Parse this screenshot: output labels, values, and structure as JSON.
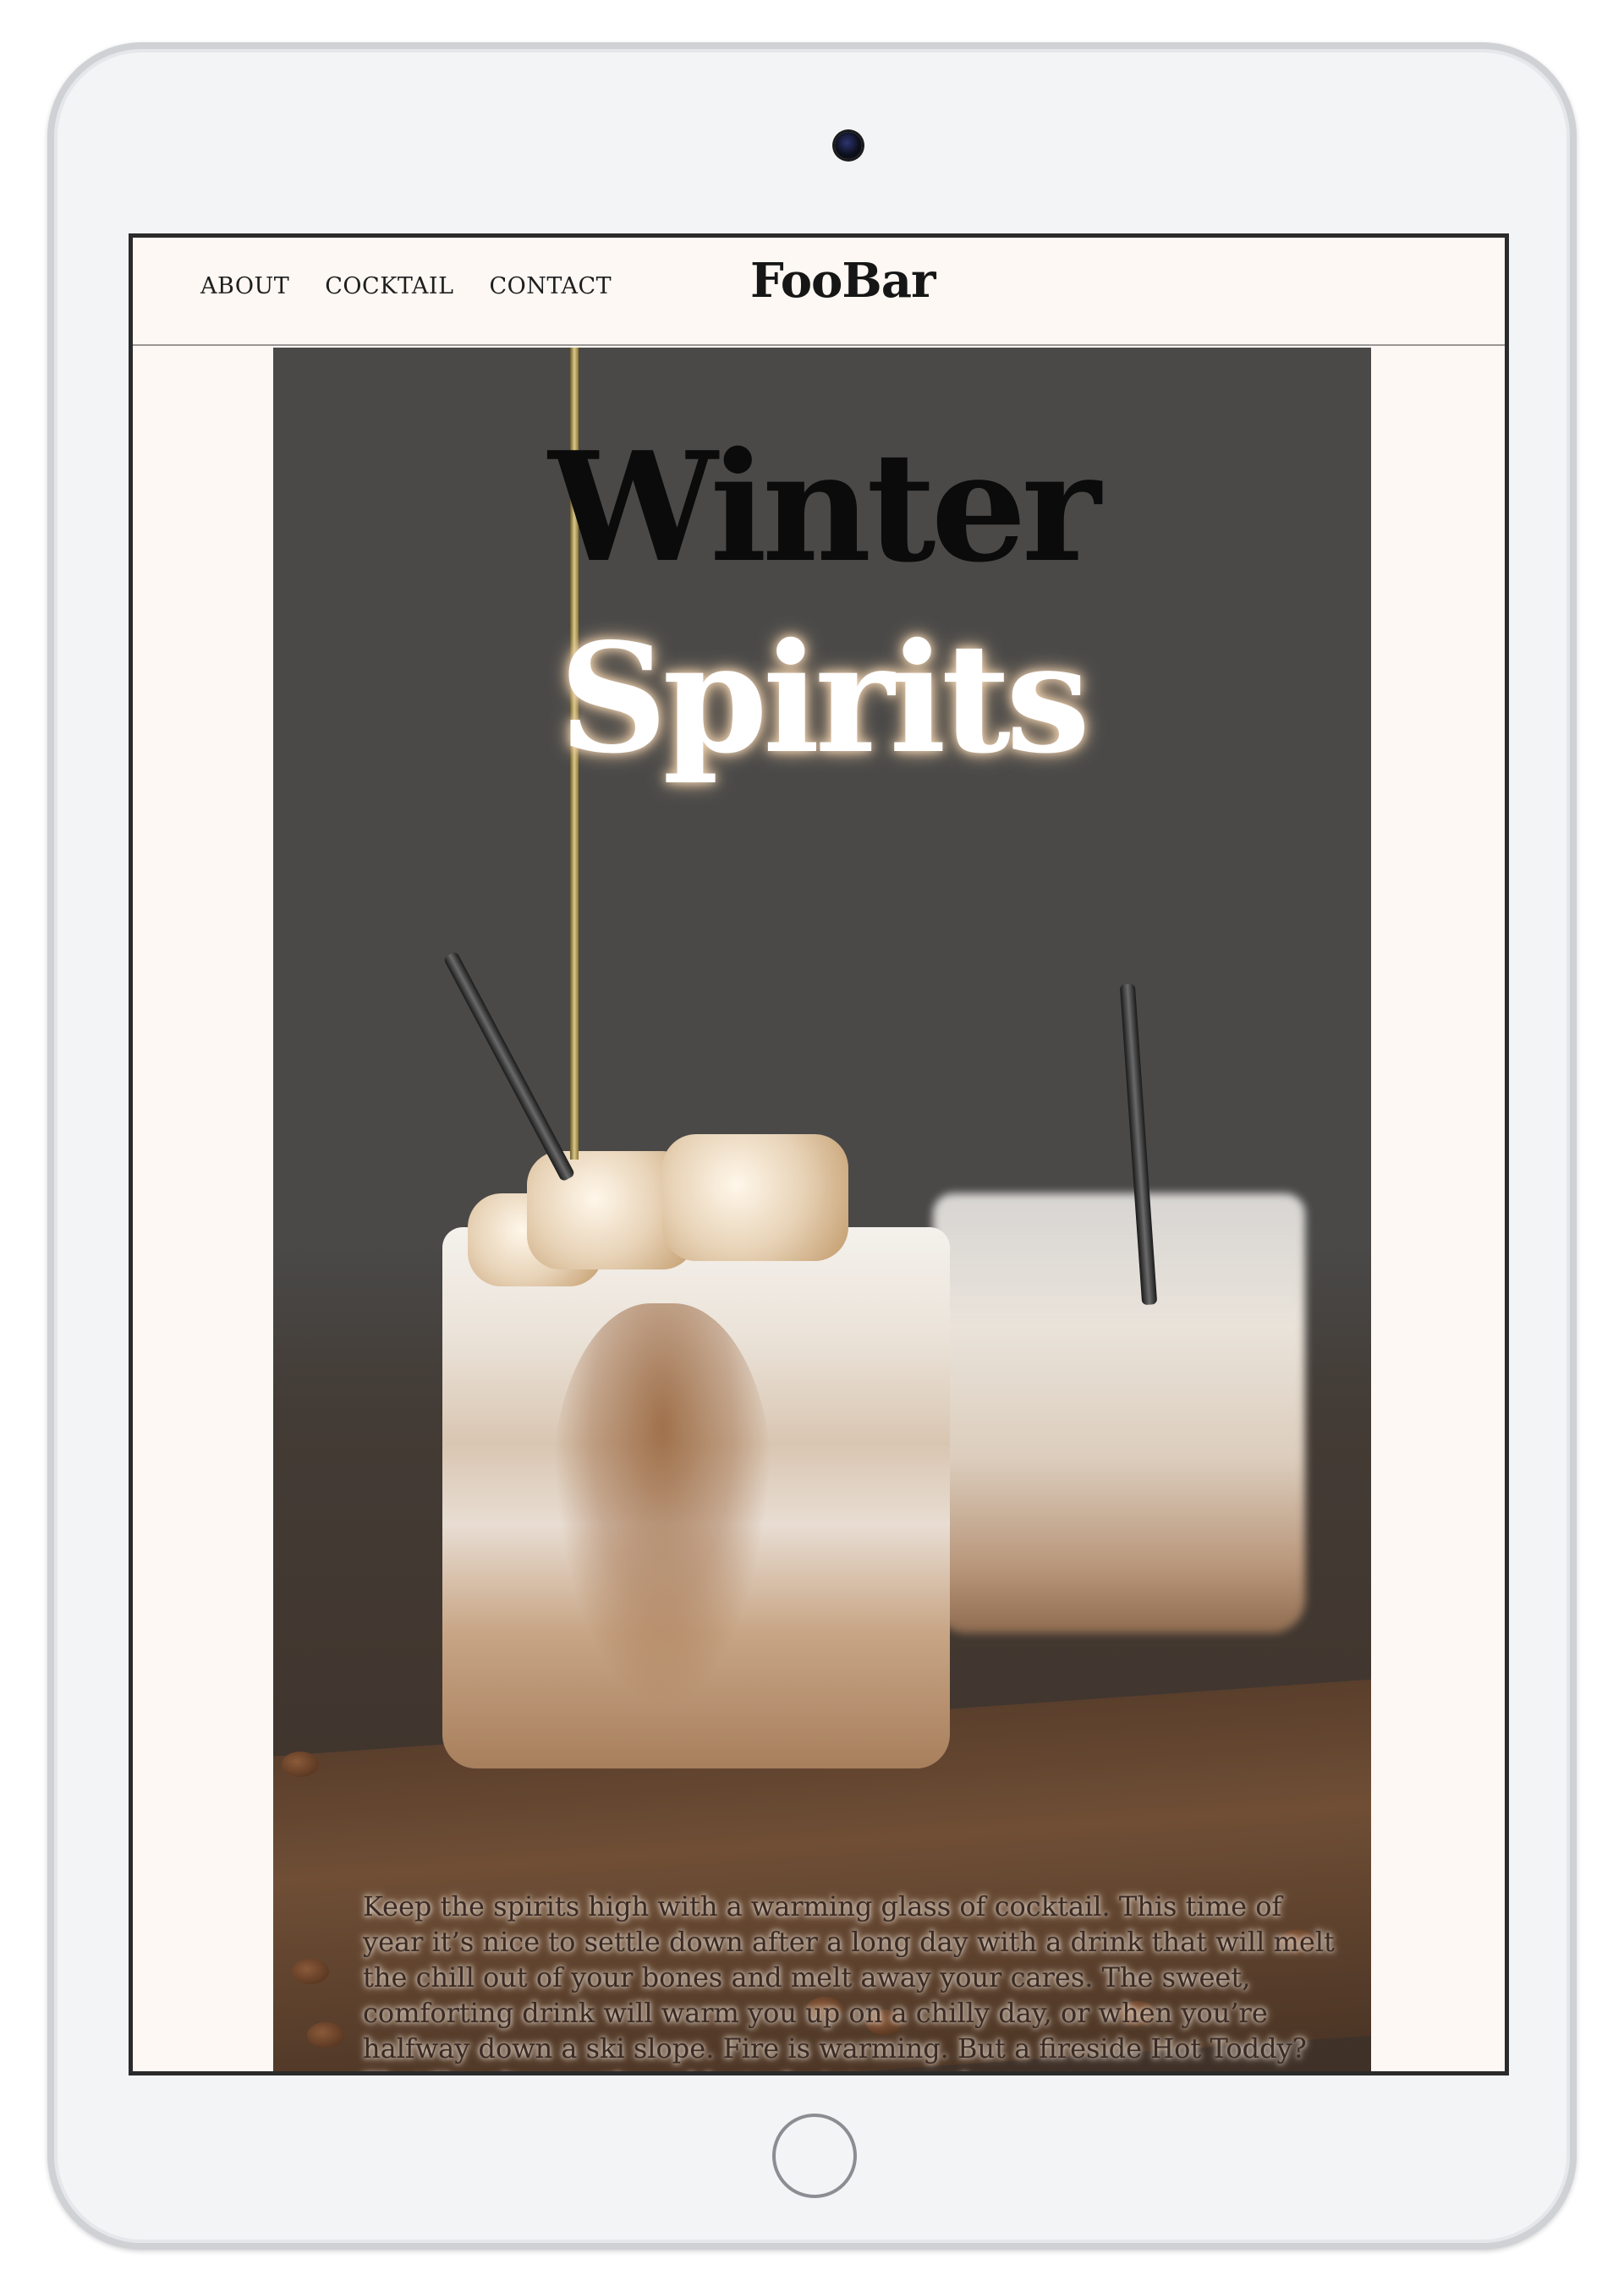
{
  "nav": {
    "links": [
      "ABOUT",
      "COCKTAIL",
      "CONTACT"
    ],
    "logo": "FooBar"
  },
  "hero": {
    "title_line1": "Winter",
    "title_line2": "Spirits",
    "body": "Keep the spirits high with a warming glass of cocktail. This time of year it’s nice to settle down after a long day with a drink that will melt the chill out of your bones and melt away your cares. The sweet, comforting drink will warm you up on a chilly day, or when you’re halfway down a ski slope. Fire is warming. But a fireside Hot Toddy? That’ll melt even the coldest of winter wanderers."
  },
  "colors": {
    "page_background": "#fdf8f3",
    "hero_background": "#4a4948",
    "title_dark": "#0b0b0b",
    "title_light": "#ffffff"
  },
  "device": {
    "camera_icon": "camera-icon",
    "home_button_icon": "home-button-icon"
  }
}
